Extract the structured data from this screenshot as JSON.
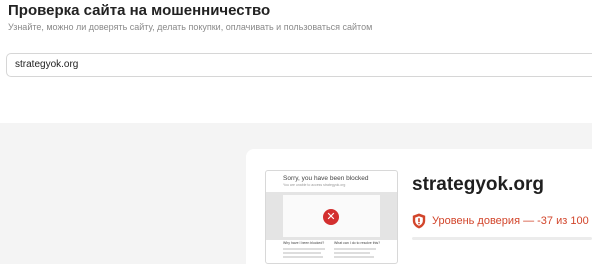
{
  "header": {
    "title": "Проверка сайта на мошенничество",
    "subtitle": "Узнайте, можно ли доверять сайту, делать покупки, оплачивать и пользоваться сайтом"
  },
  "search": {
    "value": "strategyok.org"
  },
  "result": {
    "domain": "strategyok.org",
    "trust_text": "Уровень доверия — -37 из 100",
    "trust_color": "#d2452b",
    "screenshot": {
      "heading": "Sorry, you have been blocked",
      "subheading": "You are unable to access strategyok.org",
      "question_left": "Why have I been blocked?",
      "question_right": "What can I do to resolve this?",
      "icon": "close-icon"
    }
  }
}
